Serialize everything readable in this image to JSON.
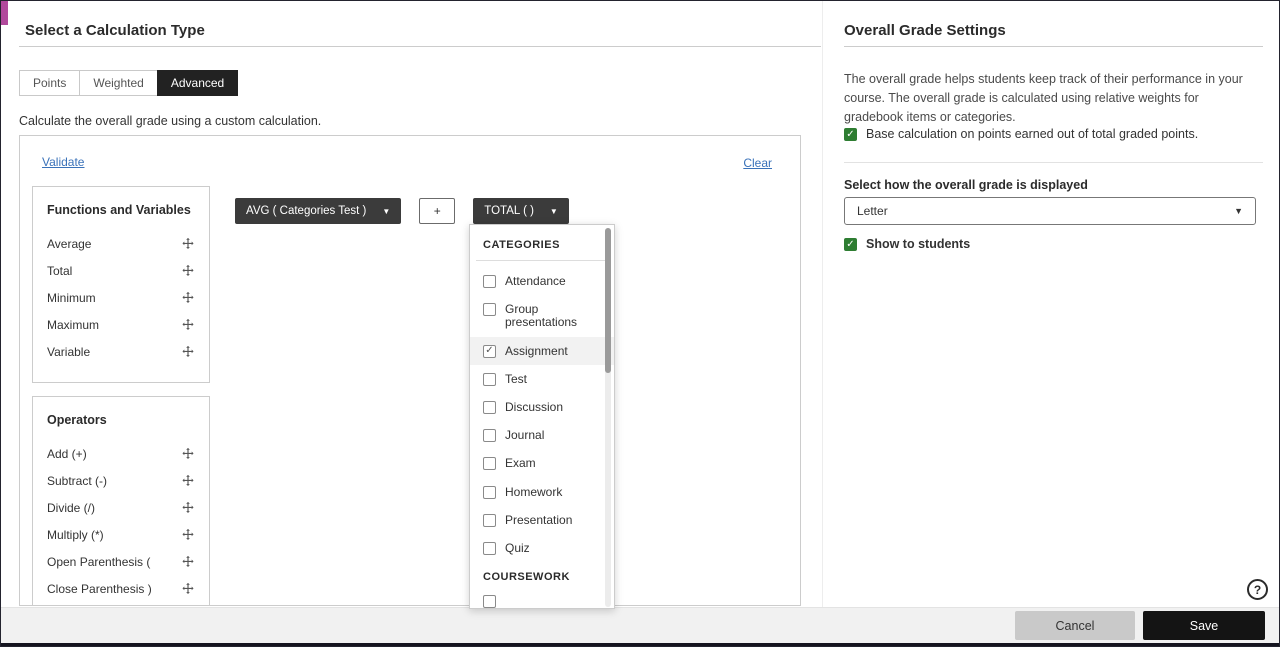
{
  "header": {
    "title": "Select a Calculation Type"
  },
  "tabs": [
    {
      "label": "Points",
      "active": false
    },
    {
      "label": "Weighted",
      "active": false
    },
    {
      "label": "Advanced",
      "active": true
    }
  ],
  "description": "Calculate the overall grade using a custom calculation.",
  "builder": {
    "validate_label": "Validate",
    "clear_label": "Clear",
    "functions_panel": {
      "title": "Functions and Variables",
      "items": [
        {
          "label": "Average"
        },
        {
          "label": "Total"
        },
        {
          "label": "Minimum"
        },
        {
          "label": "Maximum"
        },
        {
          "label": "Variable"
        }
      ]
    },
    "operators_panel": {
      "title": "Operators",
      "items": [
        {
          "label": "Add (+)"
        },
        {
          "label": "Subtract (-)"
        },
        {
          "label": "Divide (/)"
        },
        {
          "label": "Multiply (*)"
        },
        {
          "label": "Open Parenthesis ("
        },
        {
          "label": "Close Parenthesis )"
        }
      ]
    },
    "expression": {
      "avg_pill": "AVG ( Categories Test )",
      "operator_pill": "+",
      "total_pill": "TOTAL ( )"
    },
    "dropdown": {
      "section1": "CATEGORIES",
      "items": [
        {
          "label": "Attendance",
          "checked": false
        },
        {
          "label": "Group presentations",
          "checked": false
        },
        {
          "label": "Assignment",
          "checked": true
        },
        {
          "label": "Test",
          "checked": false
        },
        {
          "label": "Discussion",
          "checked": false
        },
        {
          "label": "Journal",
          "checked": false
        },
        {
          "label": "Exam",
          "checked": false
        },
        {
          "label": "Homework",
          "checked": false
        },
        {
          "label": "Presentation",
          "checked": false
        },
        {
          "label": "Quiz",
          "checked": false
        }
      ],
      "section2": "COURSEWORK"
    }
  },
  "settings": {
    "title": "Overall Grade Settings",
    "description": "The overall grade helps students keep track of their performance in your course. The overall grade is calculated using relative weights for gradebook items or categories.",
    "base_points": {
      "label": "Base calculation on points earned out of total graded points.",
      "checked": true
    },
    "display_label": "Select how the overall grade is displayed",
    "display_value": "Letter",
    "show_students": {
      "label": "Show to students",
      "checked": true
    }
  },
  "footer": {
    "cancel_label": "Cancel",
    "save_label": "Save"
  },
  "help": {
    "icon": "?"
  },
  "colors": {
    "accent": "#b1499c",
    "checkbox_green": "#2e7d32",
    "pill_dark": "#3b3b3b",
    "link_blue": "#3a72b9"
  }
}
